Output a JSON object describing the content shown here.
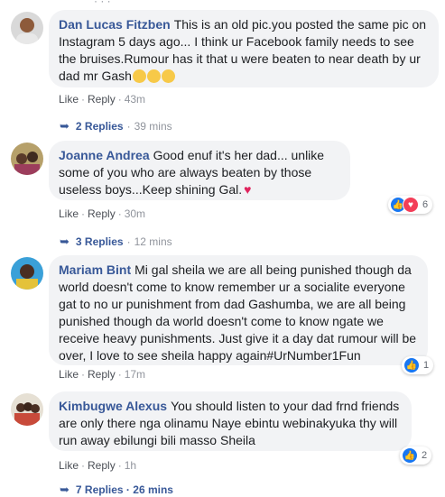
{
  "top_fragment": "· · ·",
  "comments": [
    {
      "author": "Dan Lucas Fitzben",
      "text": "This is an old pic.you posted the same pic on Instagram 5 days ago... I think ur Facebook family needs to see the bruises.Rumour has it that u were beaten to near death by ur dad mr Gash",
      "like": "Like",
      "reply": "Reply",
      "time": "43m",
      "replies": "2 Replies",
      "replies_time": "39 mins"
    },
    {
      "author": "Joanne Andrea",
      "text": "Good enuf it's her dad... unlike some of you who are always beaten by those useless boys...Keep shining Gal.",
      "like": "Like",
      "reply": "Reply",
      "time": "30m",
      "replies": "3 Replies",
      "replies_time": "12 mins",
      "reaction_count": "6"
    },
    {
      "author": "Mariam Bint",
      "text": "Mi gal sheila we are all being punished though da world doesn't come to know remember ur a socialite everyone gat to no ur punishment from dad Gashumba, we are all being punished though da world doesn't come to know ngate we receive heavy punishments. Just give it a day dat rumour will be over, I love to see sheila happy again#UrNumber1Fun",
      "like": "Like",
      "reply": "Reply",
      "time": "17m",
      "reaction_count": "1"
    },
    {
      "author": "Kimbugwe Alexus",
      "text": "You should listen to your dad frnd friends are only there nga olinamu Naye ebintu webinakyuka thy will run away ebilungi bili masso Sheila",
      "like": "Like",
      "reply": "Reply",
      "time": "1h",
      "reaction_count": "2",
      "replies_partial": "7 Replies · 26 mins"
    }
  ],
  "colors": {
    "author": "#385898",
    "bubble": "#f2f3f5",
    "meta": "#90949c",
    "like_blue": "#1877f2",
    "love_red": "#f33e58"
  }
}
